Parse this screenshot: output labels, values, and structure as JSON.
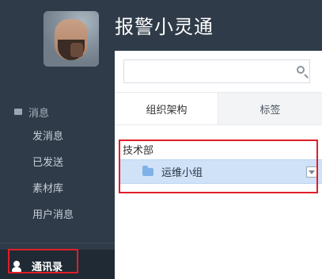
{
  "app": {
    "title": "报警小灵通"
  },
  "sidebar": {
    "section_label": "消息",
    "items": [
      {
        "label": "发消息"
      },
      {
        "label": "已发送"
      },
      {
        "label": "素材库"
      },
      {
        "label": "用户消息"
      }
    ],
    "contacts_label": "通讯录"
  },
  "search": {
    "value": "",
    "placeholder": ""
  },
  "tabs": [
    {
      "label": "组织架构",
      "active": true
    },
    {
      "label": "标签",
      "active": false
    }
  ],
  "tree": {
    "department": "技术部",
    "group": "运维小组"
  },
  "colors": {
    "sidebar_bg": "#2f3b48",
    "panel_bg": "#ffffff",
    "highlight_red": "#e11e28",
    "selected_row_bg": "#cfe2f7"
  },
  "icons": {
    "search": "search-icon",
    "messages": "message-icon",
    "contacts": "contacts-icon",
    "folder": "folder-icon",
    "dropdown": "chevron-down-icon"
  }
}
